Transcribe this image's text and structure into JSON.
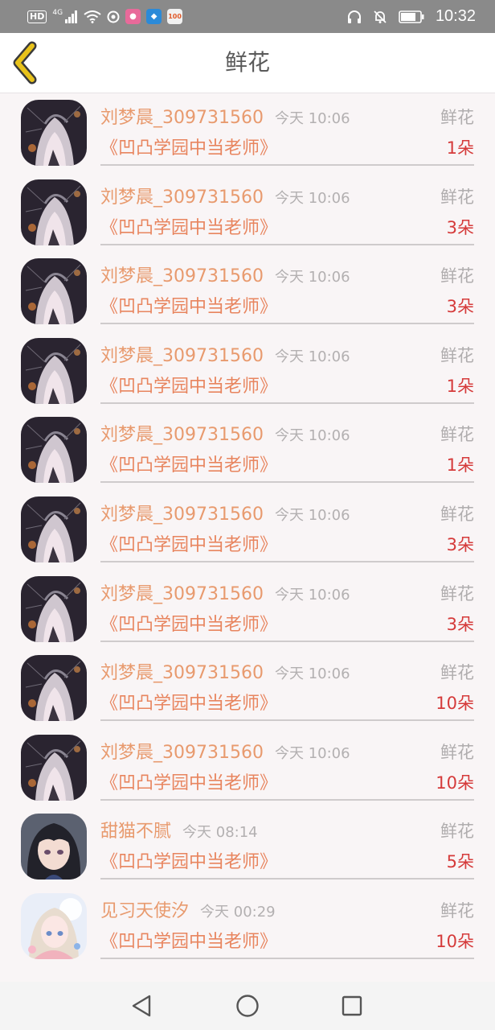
{
  "status_bar": {
    "left_icons": [
      "hd-icon",
      "signal-4g-icon",
      "wifi-icon",
      "hotspot-icon",
      "app-icon-pink",
      "app-icon-blue",
      "app-icon-100"
    ],
    "hd": "HD",
    "network": "4G",
    "app_100_label": "100",
    "right_icons": [
      "headphones-icon",
      "mute-bell-icon",
      "battery-icon"
    ],
    "time": "10:32"
  },
  "header": {
    "title": "鲜花",
    "back_icon": "chevron-left-icon",
    "accent_color": "#e8c21a"
  },
  "colors": {
    "name": "#e89a6e",
    "book": "#e8855f",
    "count": "#d53a3a",
    "muted": "#b0adae"
  },
  "items": [
    {
      "name": "刘梦晨_309731560",
      "time": "今天 10:06",
      "type": "鲜花",
      "book": "《凹凸学园中当老师》",
      "count": "1朵",
      "avatar": "dark-anime"
    },
    {
      "name": "刘梦晨_309731560",
      "time": "今天 10:06",
      "type": "鲜花",
      "book": "《凹凸学园中当老师》",
      "count": "3朵",
      "avatar": "dark-anime"
    },
    {
      "name": "刘梦晨_309731560",
      "time": "今天 10:06",
      "type": "鲜花",
      "book": "《凹凸学园中当老师》",
      "count": "3朵",
      "avatar": "dark-anime"
    },
    {
      "name": "刘梦晨_309731560",
      "time": "今天 10:06",
      "type": "鲜花",
      "book": "《凹凸学园中当老师》",
      "count": "1朵",
      "avatar": "dark-anime"
    },
    {
      "name": "刘梦晨_309731560",
      "time": "今天 10:06",
      "type": "鲜花",
      "book": "《凹凸学园中当老师》",
      "count": "1朵",
      "avatar": "dark-anime"
    },
    {
      "name": "刘梦晨_309731560",
      "time": "今天 10:06",
      "type": "鲜花",
      "book": "《凹凸学园中当老师》",
      "count": "3朵",
      "avatar": "dark-anime"
    },
    {
      "name": "刘梦晨_309731560",
      "time": "今天 10:06",
      "type": "鲜花",
      "book": "《凹凸学园中当老师》",
      "count": "3朵",
      "avatar": "dark-anime"
    },
    {
      "name": "刘梦晨_309731560",
      "time": "今天 10:06",
      "type": "鲜花",
      "book": "《凹凸学园中当老师》",
      "count": "10朵",
      "avatar": "dark-anime"
    },
    {
      "name": "刘梦晨_309731560",
      "time": "今天 10:06",
      "type": "鲜花",
      "book": "《凹凸学园中当老师》",
      "count": "10朵",
      "avatar": "dark-anime"
    },
    {
      "name": "甜猫不腻",
      "time": "今天 08:14",
      "type": "鲜花",
      "book": "《凹凸学园中当老师》",
      "count": "5朵",
      "avatar": "dark-hair"
    },
    {
      "name": "见习天使汐",
      "time": "今天 00:29",
      "type": "鲜花",
      "book": "《凹凸学园中当老师》",
      "count": "10朵",
      "avatar": "light-anime"
    }
  ],
  "nav_bar": {
    "buttons": [
      "back-triangle-icon",
      "home-circle-icon",
      "recents-square-icon"
    ]
  }
}
